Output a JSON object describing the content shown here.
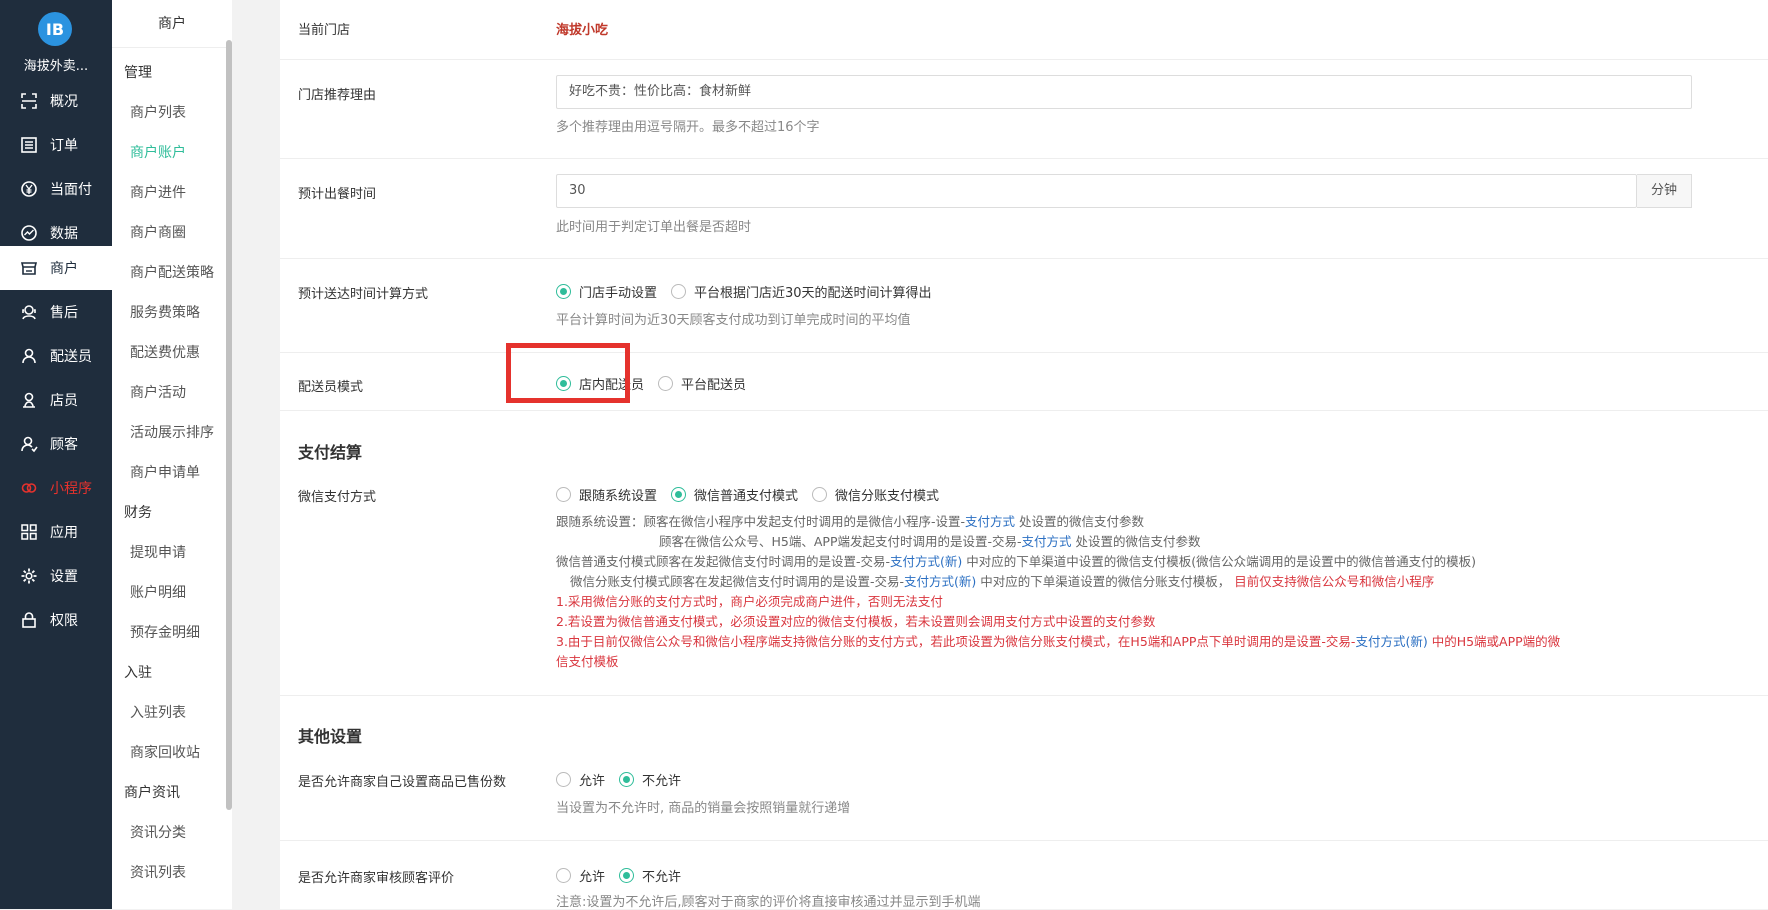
{
  "brand": {
    "logo_text": "IB",
    "name": "海拔外卖..."
  },
  "rail": [
    {
      "label": "概况",
      "icon": "overview-icon"
    },
    {
      "label": "订单",
      "icon": "order-icon"
    },
    {
      "label": "当面付",
      "icon": "yuan-icon"
    },
    {
      "label": "数据",
      "icon": "chart-icon"
    },
    {
      "label": "商户",
      "icon": "store-icon"
    },
    {
      "label": "售后",
      "icon": "aftersale-icon"
    },
    {
      "label": "配送员",
      "icon": "courier-icon"
    },
    {
      "label": "店员",
      "icon": "clerk-icon"
    },
    {
      "label": "顾客",
      "icon": "customer-icon"
    },
    {
      "label": "小程序",
      "icon": "miniapp-icon"
    },
    {
      "label": "应用",
      "icon": "apps-icon"
    },
    {
      "label": "设置",
      "icon": "gear-icon"
    },
    {
      "label": "权限",
      "icon": "lock-icon"
    }
  ],
  "submenu": {
    "title": "商户",
    "groups": [
      "管理",
      "财务",
      "入驻",
      "商户资讯"
    ],
    "items": [
      "商户列表",
      "商户账户",
      "商户进件",
      "商户商圈",
      "商户配送策略",
      "服务费策略",
      "配送费优惠",
      "商户活动",
      "活动展示排序",
      "商户申请单",
      "提现申请",
      "账户明细",
      "预存金明细",
      "入驻列表",
      "商家回收站",
      "资讯分类",
      "资讯列表"
    ]
  },
  "form": {
    "current_store_label": "当前门店",
    "current_store_value": "海拔小吃",
    "reason_label": "门店推荐理由",
    "reason_value": "好吃不贵：性价比高：食材新鲜",
    "reason_help": "多个推荐理由用逗号隔开。最多不超过16个字",
    "prep_label": "预计出餐时间",
    "prep_value": "30",
    "prep_unit": "分钟",
    "prep_help": "此时间用于判定订单出餐是否超时",
    "delivery_calc_label": "预计送达时间计算方式",
    "delivery_calc_opt1": "门店手动设置",
    "delivery_calc_opt2": "平台根据门店近30天的配送时间计算得出",
    "delivery_calc_help": "平台计算时间为近30天顾客支付成功到订单完成时间的平均值",
    "courier_mode_label": "配送员模式",
    "courier_mode_opt1": "店内配送员",
    "courier_mode_opt2": "平台配送员"
  },
  "payment": {
    "section_title": "支付结算",
    "wechat_label": "微信支付方式",
    "opt1": "跟随系统设置",
    "opt2": "微信普通支付模式",
    "opt3": "微信分账支付模式",
    "n1a": "跟随系统设置：顾客在微信小程序中发起支付时调用的是微信小程序-设置-",
    "n1link": "支付方式",
    "n1b": "处设置的微信支付参数",
    "n2a": "顾客在微信公众号、H5端、APP端发起支付时调用的是设置-交易-",
    "n2link": "支付方式",
    "n2b": "处设置的微信支付参数",
    "n3a": "微信普通支付模式顾客在发起微信支付时调用的是设置-交易-",
    "n3link": "支付方式(新)",
    "n3b": "中对应的下单渠道中设置的微信支付模板(微信公众端调用的是设置中的微信普通支付的模板)",
    "n4a": "微信分账支付模式顾客在发起微信支付时调用的是设置-交易-",
    "n4link": "支付方式(新)",
    "n4b": "中对应的下单渠道设置的微信分账支付模板，",
    "n4red": "目前仅支持微信公众号和微信小程序",
    "r1": "1.采用微信分账的支付方式时，商户必须完成商户进件，否则无法支付",
    "r2": "2.若设置为微信普通支付模式，必须设置对应的微信支付模板，若未设置则会调用支付方式中设置的支付参数",
    "r3a": "3.由于目前仅微信公众号和微信小程序端支持微信分账的支付方式，若此项设置为微信分账支付模式，在H5端和APP点下单时调用的是设置-交易-",
    "r3link": "支付方式(新)",
    "r3b": "中的H5端或APP端的微",
    "r3c": "信支付模板"
  },
  "other": {
    "section_title": "其他设置",
    "sold_label": "是否允许商家自己设置商品已售份数",
    "allow": "允许",
    "disallow": "不允许",
    "sold_help": "当设置为不允许时, 商品的销量会按照销量就行递增",
    "review_label": "是否允许商家审核顾客评价",
    "review_help": "注意:设置为不允许后,顾客对于商家的评价将直接审核通过并显示到手机端"
  },
  "colors": {
    "accent": "#2fbd9a",
    "rail_bg": "#1f2d3d",
    "highlight_box": "#e5322d",
    "link": "#2b6fc2"
  }
}
